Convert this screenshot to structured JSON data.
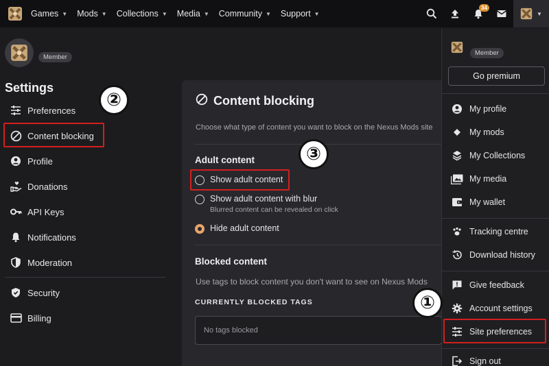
{
  "nav": {
    "items": [
      "Games",
      "Mods",
      "Collections",
      "Media",
      "Community",
      "Support"
    ],
    "notification_count": "34"
  },
  "sidebar": {
    "member_label": "Member",
    "title": "Settings",
    "items": [
      {
        "label": "Preferences",
        "icon": "sliders-icon"
      },
      {
        "label": "Content blocking",
        "icon": "block-icon"
      },
      {
        "label": "Profile",
        "icon": "user-icon"
      },
      {
        "label": "Donations",
        "icon": "donate-icon"
      },
      {
        "label": "API Keys",
        "icon": "key-icon"
      },
      {
        "label": "Notifications",
        "icon": "bell-icon"
      },
      {
        "label": "Moderation",
        "icon": "shield-icon"
      },
      {
        "label": "Security",
        "icon": "security-shield-icon"
      },
      {
        "label": "Billing",
        "icon": "card-icon"
      }
    ]
  },
  "main": {
    "title": "Content blocking",
    "description": "Choose what type of content you want to block on the Nexus Mods site",
    "adult_title": "Adult content",
    "options": [
      {
        "label": "Show adult content",
        "sub": "",
        "selected": false
      },
      {
        "label": "Show adult content with blur",
        "sub": "Blurred content can be revealed on click",
        "selected": false
      },
      {
        "label": "Hide adult content",
        "sub": "",
        "selected": true
      }
    ],
    "blocked_title": "Blocked content",
    "blocked_desc": "Use tags to block content you don't want to see on Nexus Mods",
    "tags_heading": "CURRENTLY BLOCKED TAGS",
    "tags_placeholder": "No tags blocked"
  },
  "menu": {
    "member_label": "Member",
    "premium_label": "Go premium",
    "items": [
      {
        "label": "My profile",
        "icon": "user-icon"
      },
      {
        "label": "My mods",
        "icon": "diamond-icon"
      },
      {
        "label": "My Collections",
        "icon": "layers-icon"
      },
      {
        "label": "My media",
        "icon": "image-icon"
      },
      {
        "label": "My wallet",
        "icon": "wallet-icon"
      },
      {
        "label": "Tracking centre",
        "icon": "paw-icon"
      },
      {
        "label": "Download history",
        "icon": "history-icon"
      },
      {
        "label": "Give feedback",
        "icon": "feedback-icon"
      },
      {
        "label": "Account settings",
        "icon": "gear-icon"
      },
      {
        "label": "Site preferences",
        "icon": "sliders-icon"
      },
      {
        "label": "Sign out",
        "icon": "signout-icon"
      }
    ]
  },
  "steps": [
    "①",
    "②",
    "③"
  ],
  "colors": {
    "highlight": "#d41f1f",
    "accent": "#e9a56a",
    "badge": "#d98f2e"
  }
}
